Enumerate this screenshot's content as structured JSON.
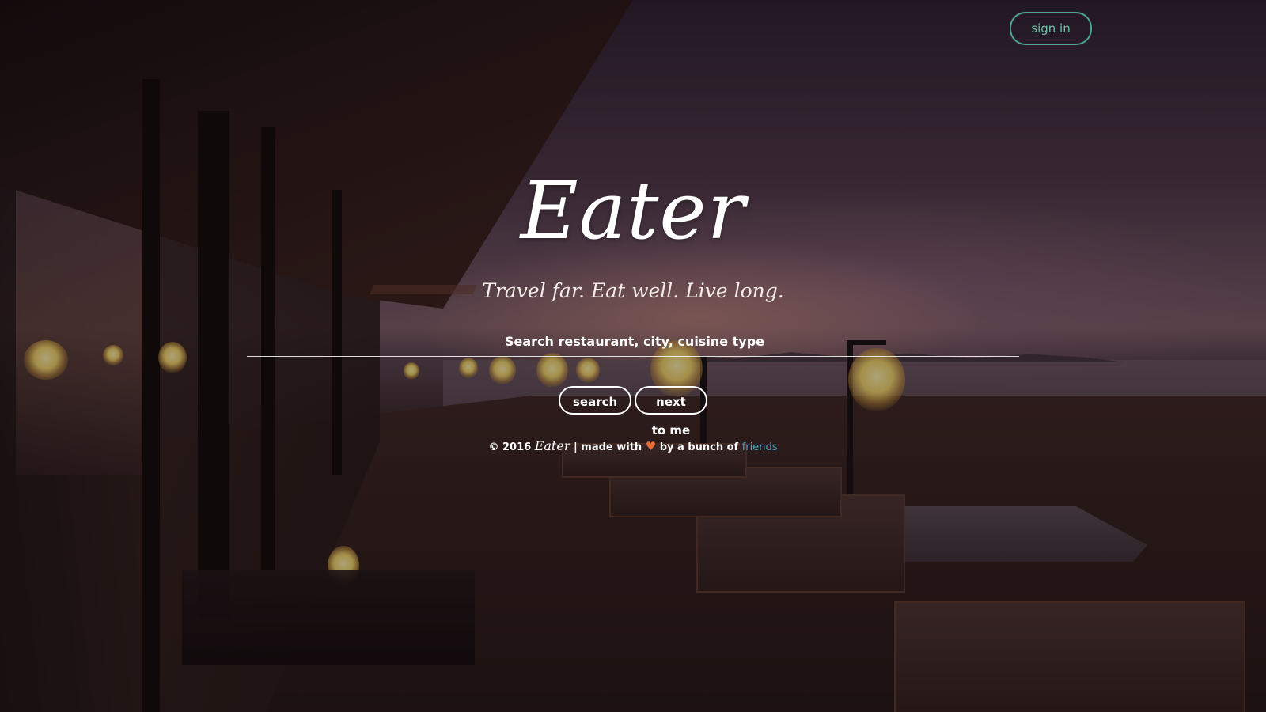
{
  "header": {
    "signin_label": "sign in"
  },
  "hero": {
    "logo": "Eater",
    "tagline": "Travel far. Eat well. Live long."
  },
  "search": {
    "placeholder": "Search restaurant, city, cuisine type",
    "value": ""
  },
  "actions": {
    "search_label": "search",
    "near_label": "next to me"
  },
  "footer": {
    "copyright": "© 2016",
    "brand": "Eater",
    "made_with": "| made with",
    "heart": "♥",
    "by": "by a bunch of",
    "link": "friends"
  },
  "colors": {
    "accent_green": "#4fa68f",
    "link_blue": "#4fa6c0",
    "heart_orange": "#e8693a"
  }
}
